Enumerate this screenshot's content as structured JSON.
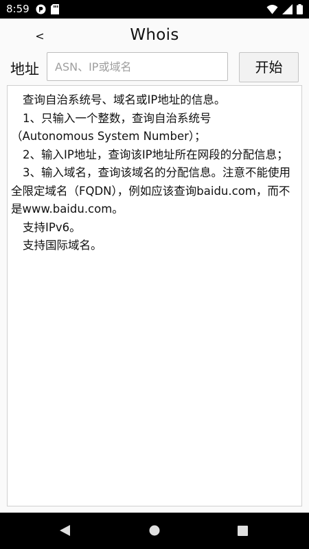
{
  "status_bar": {
    "time": "8:59"
  },
  "header": {
    "back_label": "<",
    "title": "Whois"
  },
  "form": {
    "address_label": "地址",
    "address_placeholder": "ASN、IP或域名",
    "address_value": "",
    "start_label": "开始"
  },
  "info": {
    "lines": [
      "查询自治系统号、域名或IP地址的信息。",
      "1、只输入一个整数，查询自治系统号（Autonomous System Number）；",
      "2、输入IP地址，查询该IP地址所在网段的分配信息；",
      "3、输入域名，查询该域名的分配信息。注意不能使用全限定域名（FQDN），例如应该查询baidu.com，而不是www.baidu.com。",
      "支持IPv6。",
      "支持国际域名。"
    ]
  },
  "icons": {
    "status_left": [
      "notification-icon",
      "sd-card-icon"
    ],
    "status_right": [
      "wifi-icon",
      "signal-icon",
      "battery-icon"
    ],
    "nav": [
      "nav-back-icon",
      "nav-home-icon",
      "nav-recents-icon"
    ]
  },
  "colors": {
    "status_bar_bg": "#000000",
    "app_bg": "#fafafa",
    "nav_bar_bg": "#000000"
  }
}
